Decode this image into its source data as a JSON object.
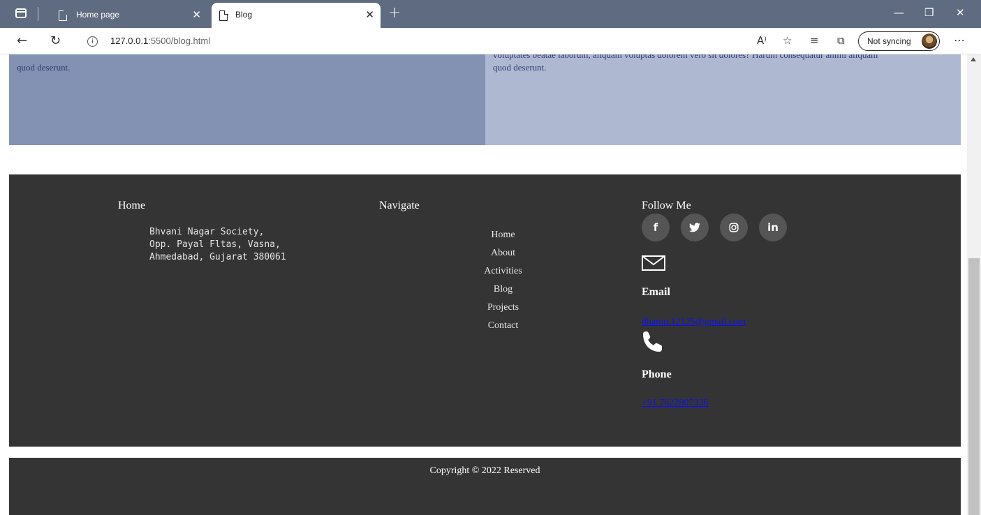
{
  "browser": {
    "tabs": [
      {
        "title": "Home page",
        "close": "✕"
      },
      {
        "title": "Blog",
        "close": "✕"
      }
    ],
    "new_tab": "+",
    "window": {
      "minimize": "—",
      "restore": "❐",
      "close": "✕"
    },
    "url_host": "127.0.0.1",
    "url_rest": ":5500/blog.html",
    "read_aloud": "A⁾",
    "sync_label": "Not syncing",
    "more": "⋯"
  },
  "blog": {
    "left_text": "quod deserunt.",
    "right_text_partial": "voluptates beatae laborum, aliquam voluptas dolorem vero sit dolores? Harum consequatur animi aliquam",
    "right_text": "quod deserunt."
  },
  "footer": {
    "home_heading": "Home",
    "navigate_heading": "Navigate",
    "follow_heading": "Follow Me",
    "address": [
      "Bhvani Nagar Society,",
      "Opp. Payal Fltas, Vasna,",
      "Ahmedabad, Gujarat 380061"
    ],
    "nav_links": [
      "Home",
      "About",
      "Activities",
      "Blog",
      "Projects",
      "Contact"
    ],
    "socials": [
      {
        "label": "f",
        "icon": "facebook-icon"
      },
      {
        "label": "🐦",
        "icon": "twitter-icon"
      },
      {
        "label": "◎",
        "icon": "instagram-icon"
      },
      {
        "label": "in",
        "icon": "linkedin-icon"
      }
    ],
    "email_label": "Email",
    "email": "dhamu.12125@gmail.com",
    "phone_label": "Phone",
    "phone": "+91 7622807336"
  },
  "copyright": "Copyright © 2022 Reserved",
  "colors": {
    "tabbar": "#5f6b80",
    "footer": "#343434",
    "blog_left": "#8391b2",
    "blog_right": "#aeb8d1",
    "link": "#1010ee"
  }
}
